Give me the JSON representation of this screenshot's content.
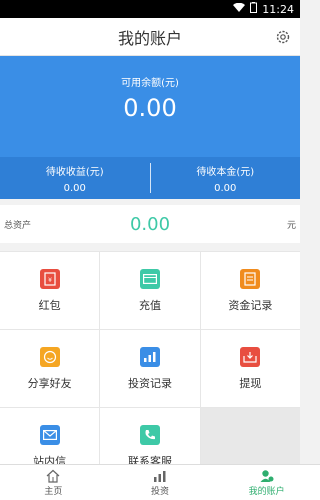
{
  "status": {
    "time": "11:24"
  },
  "header": {
    "title": "我的账户"
  },
  "balance": {
    "label": "可用余额(元)",
    "value": "0.00",
    "pending_income_label": "待收收益(元)",
    "pending_income_value": "0.00",
    "pending_principal_label": "待收本金(元)",
    "pending_principal_value": "0.00"
  },
  "assets": {
    "label": "总资产",
    "value": "0.00",
    "unit": "元"
  },
  "grid": [
    {
      "label": "红包",
      "icon": "red-envelope-icon",
      "color": "#e84e40"
    },
    {
      "label": "充值",
      "icon": "card-icon",
      "color": "#3ec9a7"
    },
    {
      "label": "资金记录",
      "icon": "document-icon",
      "color": "#f08c1e"
    },
    {
      "label": "分享好友",
      "icon": "smile-icon",
      "color": "#f5a623"
    },
    {
      "label": "投资记录",
      "icon": "chart-icon",
      "color": "#3a8ee6"
    },
    {
      "label": "提现",
      "icon": "withdraw-icon",
      "color": "#e84e40"
    },
    {
      "label": "站内信",
      "icon": "mail-icon",
      "color": "#3a8ee6"
    },
    {
      "label": "联系客服",
      "icon": "phone-icon",
      "color": "#3ec9a7"
    }
  ],
  "tabs": [
    {
      "label": "主页",
      "icon": "home-icon"
    },
    {
      "label": "投资",
      "icon": "invest-chart-icon"
    },
    {
      "label": "我的账户",
      "icon": "account-icon",
      "active": true
    }
  ],
  "colors": {
    "primary": "#3a8ee6",
    "accent": "#3ec9a7",
    "active_tab": "#2fae6f"
  }
}
